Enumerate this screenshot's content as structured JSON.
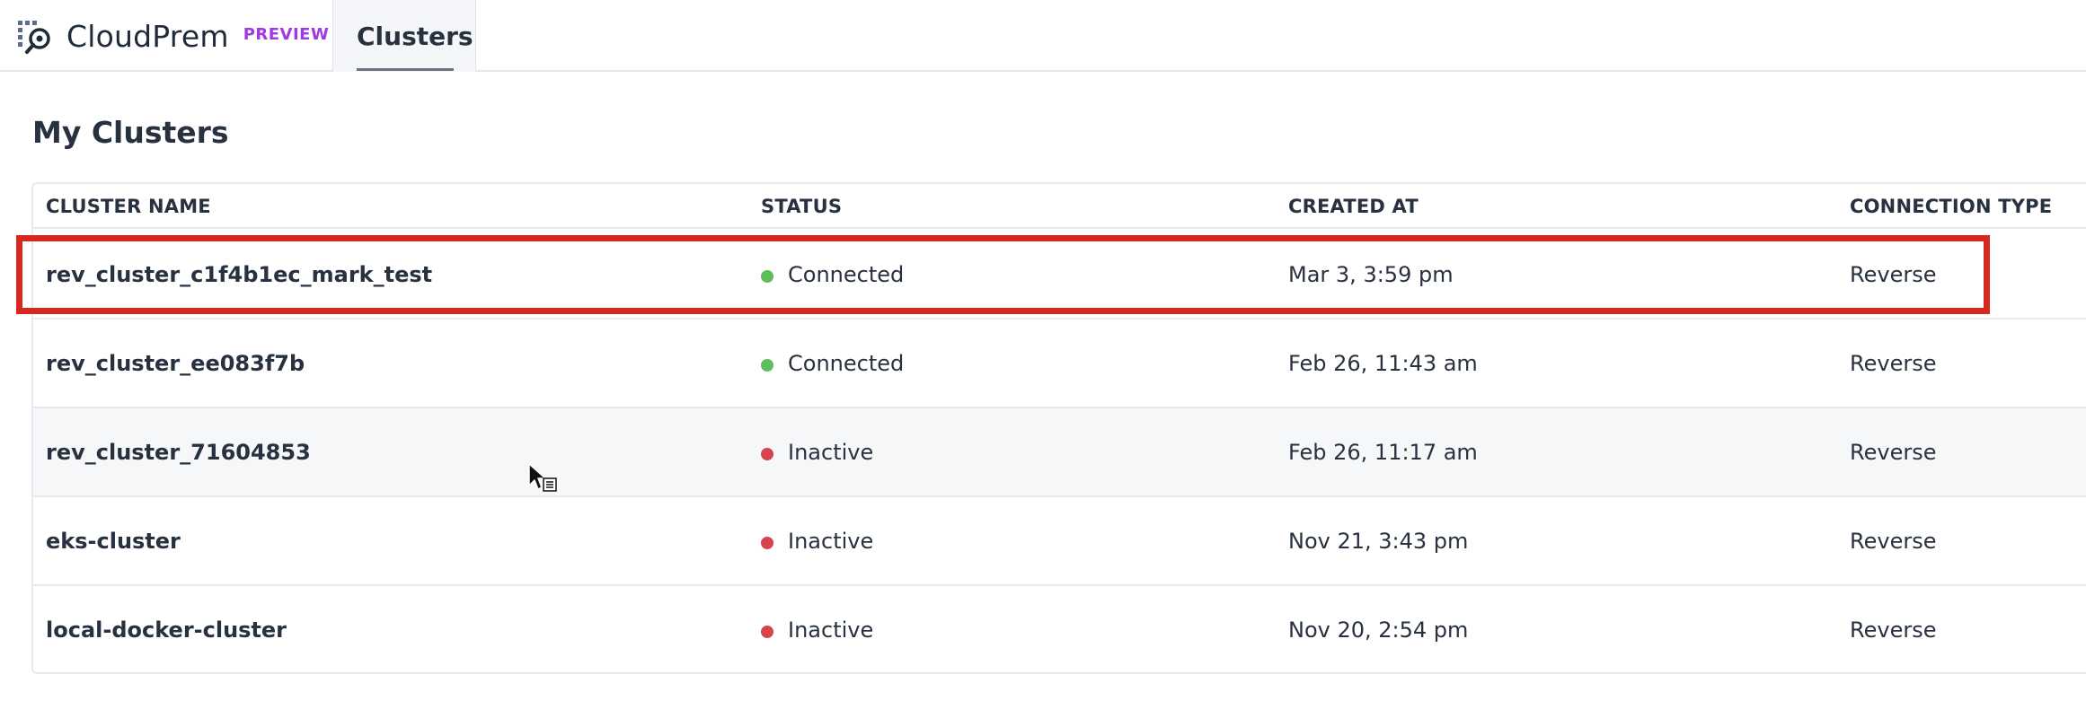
{
  "app": {
    "name": "CloudPrem",
    "badge": "PREVIEW",
    "brand_icon": "cloudprem-logo-icon"
  },
  "tabs": [
    {
      "label": "Clusters",
      "active": true
    }
  ],
  "page": {
    "title": "My Clusters"
  },
  "table": {
    "columns": [
      "CLUSTER NAME",
      "STATUS",
      "CREATED AT",
      "CONNECTION TYPE"
    ],
    "rows": [
      {
        "name": "rev_cluster_c1f4b1ec_mark_test",
        "status": "Connected",
        "status_color": "#5cbf5a",
        "created": "Mar 3, 3:59 pm",
        "connection": "Reverse",
        "highlighted": true
      },
      {
        "name": "rev_cluster_ee083f7b",
        "status": "Connected",
        "status_color": "#5cbf5a",
        "created": "Feb 26, 11:43 am",
        "connection": "Reverse"
      },
      {
        "name": "rev_cluster_71604853",
        "status": "Inactive",
        "status_color": "#d9434e",
        "created": "Feb 26, 11:17 am",
        "connection": "Reverse"
      },
      {
        "name": "eks-cluster",
        "status": "Inactive",
        "status_color": "#d9434e",
        "created": "Nov 21, 3:43 pm",
        "connection": "Reverse"
      },
      {
        "name": "local-docker-cluster",
        "status": "Inactive",
        "status_color": "#d9434e",
        "created": "Nov 20, 2:54 pm",
        "connection": "Reverse"
      }
    ]
  },
  "colors": {
    "accent_badge": "#a238e0",
    "highlight_border": "#d6281f",
    "connected": "#5cbf5a",
    "inactive": "#d9434e"
  }
}
